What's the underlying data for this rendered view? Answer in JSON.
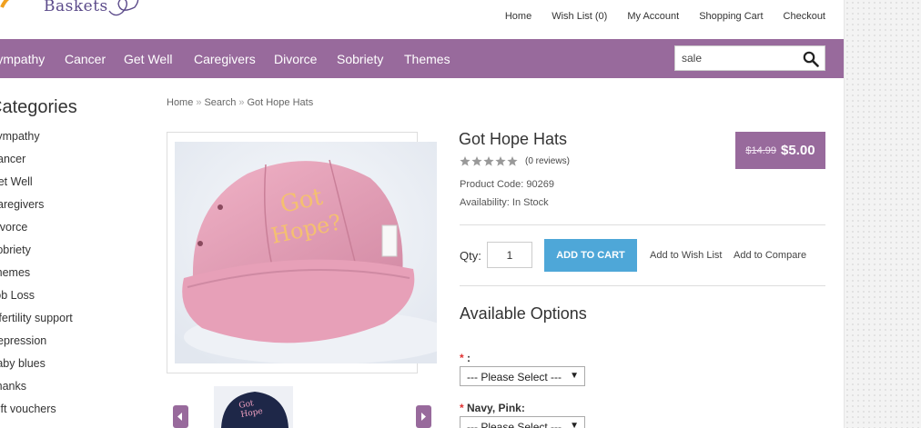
{
  "brand": {
    "logo_text": "Baskets"
  },
  "top_links": [
    "Home",
    "Wish List (0)",
    "My Account",
    "Shopping Cart",
    "Checkout"
  ],
  "nav": {
    "items": [
      "Sympathy",
      "Cancer",
      "Get Well",
      "Caregivers",
      "Divorce",
      "Sobriety",
      "Themes"
    ],
    "search_value": "sale"
  },
  "sidebar": {
    "title": "Categories",
    "items": [
      "Sympathy",
      "Cancer",
      "Get Well",
      "Caregivers",
      "Divorce",
      "Sobriety",
      "Themes",
      "Job Loss",
      "Infertility support",
      "Depression",
      "Baby blues",
      "Thanks",
      "Gift vouchers"
    ]
  },
  "breadcrumb": [
    "Home",
    "Search",
    "Got Hope Hats"
  ],
  "product": {
    "title": "Got Hope Hats",
    "rating": 0,
    "reviews": "(0 reviews)",
    "code_label": "Product Code:",
    "code": "90269",
    "availability_label": "Availability:",
    "availability": "In Stock",
    "price_old": "$14.99",
    "price_new": "$5.00"
  },
  "cart": {
    "qty_label": "Qty:",
    "qty_value": "1",
    "add_button": "ADD TO CART",
    "wish_link": "Add to Wish List",
    "compare_link": "Add to Compare"
  },
  "options": {
    "title": "Available Options",
    "fields": [
      {
        "label": ":",
        "required": "*",
        "selected": "--- Please Select ---"
      },
      {
        "label": "Navy, Pink:",
        "required": "*",
        "selected": "--- Please Select ---"
      }
    ]
  },
  "colors": {
    "brand_purple": "#986a9c",
    "cart_blue": "#4ea7d8",
    "required_red": "#e03030"
  }
}
